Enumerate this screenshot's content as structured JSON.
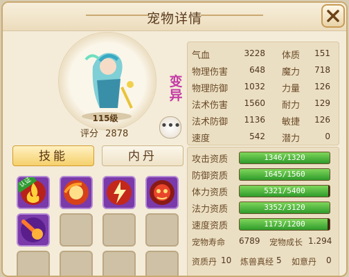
{
  "title": "宠物详情",
  "pet": {
    "morph_badge": "变异",
    "level": "115级",
    "score_label": "评分",
    "score_value": "2878",
    "more_button": "•••"
  },
  "tabs": [
    {
      "label": "技能",
      "active": true
    },
    {
      "label": "内丹",
      "active": false
    }
  ],
  "skills": {
    "cert_badge": "认证",
    "filled": [
      "fire-skill-icon",
      "fire-orb-skill-icon",
      "lightning-skill-icon",
      "demon-face-skill-icon",
      "meteor-skill-icon"
    ]
  },
  "stats": {
    "left": [
      {
        "label": "气血",
        "value": "3228"
      },
      {
        "label": "物理伤害",
        "value": "648"
      },
      {
        "label": "物理防御",
        "value": "1032"
      },
      {
        "label": "法术伤害",
        "value": "1560"
      },
      {
        "label": "法术防御",
        "value": "1136"
      },
      {
        "label": "速度",
        "value": "542"
      }
    ],
    "right": [
      {
        "label": "体质",
        "value": "151"
      },
      {
        "label": "魔力",
        "value": "718"
      },
      {
        "label": "力量",
        "value": "126"
      },
      {
        "label": "耐力",
        "value": "129"
      },
      {
        "label": "敏捷",
        "value": "126"
      },
      {
        "label": "潜力",
        "value": "0"
      }
    ]
  },
  "aptitudes": [
    {
      "label": "攻击资质",
      "text": "1346/1320",
      "fill": 1.0
    },
    {
      "label": "防御资质",
      "text": "1645/1560",
      "fill": 1.0
    },
    {
      "label": "体力资质",
      "text": "5321/5400",
      "fill": 0.985
    },
    {
      "label": "法力资质",
      "text": "3352/3120",
      "fill": 1.0
    },
    {
      "label": "速度资质",
      "text": "1173/1200",
      "fill": 0.9775
    }
  ],
  "footer": {
    "lifespan_label": "宠物寿命",
    "lifespan_value": "6789",
    "growth_label": "宠物成长",
    "growth_value": "1.294",
    "pill_label": "资质丹",
    "pill_value": "10",
    "essence_label": "炼兽真经",
    "essence_value": "5",
    "ruyi_label": "如意丹",
    "ruyi_value": "0"
  },
  "colors": {
    "accent": "#f5d06b",
    "bar_green": "#2f9b2a",
    "skill_bg": "#7a3aa9"
  }
}
